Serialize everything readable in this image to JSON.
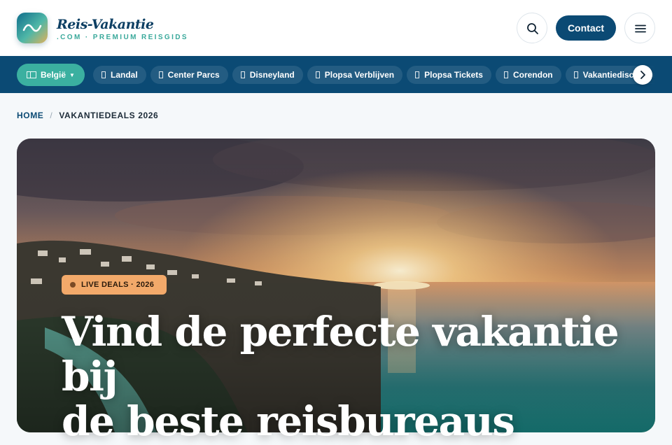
{
  "brand": {
    "name": "Reis-Vakantie",
    "sub": ".COM · PREMIUM REISGIDS"
  },
  "header": {
    "contact_label": "Contact",
    "search_icon": "search-icon",
    "menu_icon": "menu-icon"
  },
  "nav": {
    "country": "België",
    "items": [
      {
        "label": "Landal"
      },
      {
        "label": "Center Parcs"
      },
      {
        "label": "Disneyland"
      },
      {
        "label": "Plopsa Verblijven"
      },
      {
        "label": "Plopsa Tickets"
      },
      {
        "label": "Corendon"
      },
      {
        "label": "Vakantiediscounter"
      }
    ]
  },
  "breadcrumb": {
    "home": "HOME",
    "separator": "/",
    "current": "VAKANTIEDEALS 2026"
  },
  "hero": {
    "badge": "LIVE DEALS · 2026",
    "title_line1": "Vind de perfecte vakantie bij",
    "title_line2": "de beste reisbureaus"
  },
  "colors": {
    "primary": "#0b4a74",
    "accent": "#3bb0a0",
    "badge": "#f2a96a"
  }
}
